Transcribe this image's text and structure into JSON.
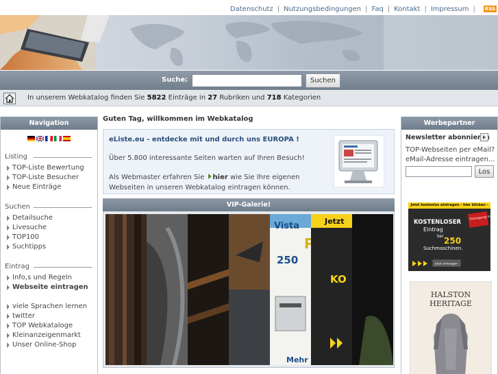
{
  "topnav": {
    "links": [
      "Datenschutz",
      "Nutzungsbedingungen",
      "Faq",
      "Kontakt",
      "Impressum"
    ],
    "rss_label": "RSS"
  },
  "search": {
    "label": "Suche:",
    "placeholder": "",
    "button": "Suchen"
  },
  "infobar": {
    "prefix": "In unserem Webkatalog finden Sie",
    "entries": "5822",
    "mid1": "Einträge in",
    "rubriken": "27",
    "mid2": "Rubriken und",
    "kategorien": "718",
    "suffix": "Kategorien"
  },
  "navigation": {
    "title": "Navigation",
    "flags": [
      "german-flag",
      "english-flag",
      "french-flag",
      "italian-flag",
      "spanish-flag"
    ],
    "sections": [
      {
        "title": "Listing",
        "items": [
          "TOP-Liste Bewertung",
          "TOP-Liste Besucher",
          "Neue Einträge"
        ]
      },
      {
        "title": "Suchen",
        "items": [
          "Detailsuche",
          "Livesuche",
          "TOP100",
          "Suchtipps"
        ]
      },
      {
        "title": "Eintrag",
        "items": [
          "Info,s und Regeln",
          "Webseite eintragen"
        ]
      }
    ],
    "extra_items": [
      "viele Sprachen lernen",
      "twitter",
      "TOP Webkataloge",
      "Kleinanzeigenmarkt",
      "Unser Online-Shop"
    ]
  },
  "main": {
    "welcome": "Guten Tag, willkommen im Webkatalog",
    "intro_title": "eListe.eu - entdecke mit und durch uns EUROPA !",
    "intro_p1": "Über 5.800 interessante Seiten warten auf Ihren Besuch!",
    "intro_p2_a": "Als Webmaster erfahren Sie",
    "intro_p2_link": "hier",
    "intro_p2_b": "wie Sie Ihre eigenen Webseiten in unseren Webkatalog eintragen können.",
    "vip_title": "VIP-Galerie!",
    "vip_texts": {
      "vista": "Vista",
      "number": "250",
      "jetzt": "Jetzt",
      "mehr": "Mehr",
      "ko": "KO"
    }
  },
  "sidebar_right": {
    "title": "Werbepartner",
    "newsletter_title": "Newsletter abonnieren",
    "newsletter_text_1": "TOP-Webseiten per eMail?",
    "newsletter_text_2": "eMail-Adresse eintragen...",
    "newsletter_button": "Los",
    "ad1": {
      "bar": "Jetzt kostenlos eintragen - hier klicken -",
      "headline": "KOSTENLOSER",
      "line2": "Eintrag",
      "line3": "bei",
      "number": "250",
      "line4": "Suchmaschinen.",
      "button": "Jetzt eintragen",
      "badge": "Eintragung in ECHTZEIT"
    },
    "ad2": {
      "title": "HALSTON HERITAGE"
    }
  },
  "colors": {
    "panel_head": "#7a8695",
    "accent_link": "#2a4f7a",
    "rss": "#f5941e",
    "ad_yellow": "#f7d21a"
  }
}
